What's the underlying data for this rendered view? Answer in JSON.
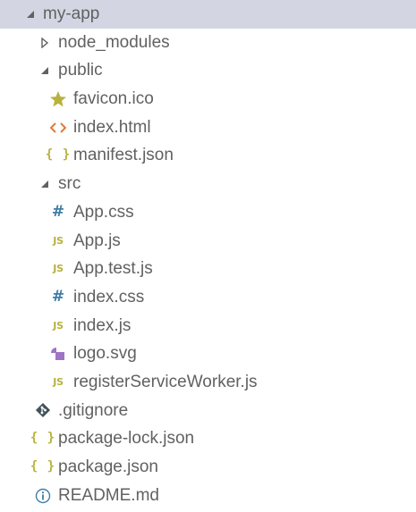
{
  "explorer": {
    "root": {
      "label": "my-app",
      "expanded": true,
      "selected": true
    },
    "items": [
      {
        "label": "node_modules",
        "type": "folder",
        "expanded": false
      },
      {
        "label": "public",
        "type": "folder",
        "expanded": true
      },
      {
        "label": "favicon.ico",
        "type": "file",
        "icon": "star-icon"
      },
      {
        "label": "index.html",
        "type": "file",
        "icon": "code-icon"
      },
      {
        "label": "manifest.json",
        "type": "file",
        "icon": "json-icon"
      },
      {
        "label": "src",
        "type": "folder",
        "expanded": true
      },
      {
        "label": "App.css",
        "type": "file",
        "icon": "hash-icon"
      },
      {
        "label": "App.js",
        "type": "file",
        "icon": "js-icon"
      },
      {
        "label": "App.test.js",
        "type": "file",
        "icon": "js-icon"
      },
      {
        "label": "index.css",
        "type": "file",
        "icon": "hash-icon"
      },
      {
        "label": "index.js",
        "type": "file",
        "icon": "js-icon"
      },
      {
        "label": "logo.svg",
        "type": "file",
        "icon": "image-icon"
      },
      {
        "label": "registerServiceWorker.js",
        "type": "file",
        "icon": "js-icon"
      },
      {
        "label": ".gitignore",
        "type": "file",
        "icon": "git-icon"
      },
      {
        "label": "package-lock.json",
        "type": "file",
        "icon": "json-icon"
      },
      {
        "label": "package.json",
        "type": "file",
        "icon": "json-icon"
      },
      {
        "label": "README.md",
        "type": "file",
        "icon": "info-icon"
      }
    ],
    "icon_labels": {
      "js": "JS",
      "json": "{ }",
      "hash": "#"
    }
  },
  "colors": {
    "selected_background": "#d3d6e2",
    "text": "#616161",
    "js_yellow": "#b8b13c",
    "css_blue": "#3f7ea6",
    "html_orange": "#e37933",
    "svg_purple": "#a074c4",
    "git_dark": "#41535b"
  }
}
